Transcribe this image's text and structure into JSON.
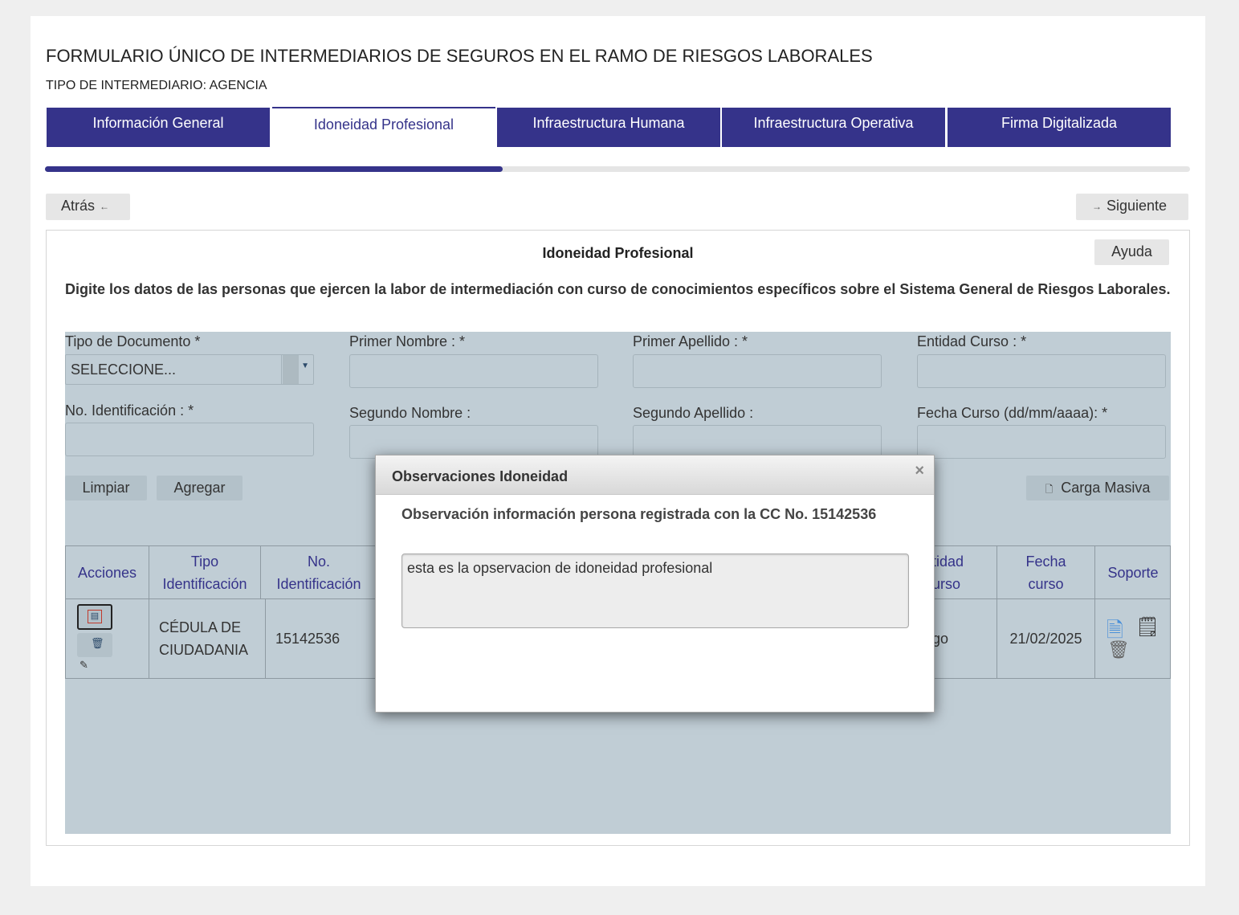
{
  "header": {
    "title": "FORMULARIO ÚNICO DE INTERMEDIARIOS DE SEGUROS EN EL RAMO DE RIESGOS LABORALES",
    "subtitle": "TIPO DE INTERMEDIARIO: AGENCIA"
  },
  "tabs": [
    {
      "label": "Información General",
      "active": false
    },
    {
      "label": "Idoneidad Profesional",
      "active": true
    },
    {
      "label": "Infraestructura Humana",
      "active": false
    },
    {
      "label": "Infraestructura Operativa",
      "active": false
    },
    {
      "label": "Firma Digitalizada",
      "active": false
    }
  ],
  "progress": {
    "fraction": 0.4
  },
  "nav": {
    "back_label": "Atrás",
    "next_label": "Siguiente"
  },
  "panel": {
    "title": "Idoneidad Profesional",
    "help_label": "Ayuda",
    "instructions": "Digite los datos de las personas que ejercen la labor de intermediación con curso de conocimientos específicos sobre el Sistema General de Riesgos Laborales."
  },
  "form": {
    "tipo_documento": {
      "label": "Tipo de Documento *",
      "value": "SELECCIONE..."
    },
    "primer_nombre": {
      "label": "Primer Nombre : *",
      "value": ""
    },
    "primer_apellido": {
      "label": "Primer Apellido : *",
      "value": ""
    },
    "entidad_curso": {
      "label": "Entidad Curso : *",
      "value": ""
    },
    "no_identificacion": {
      "label": "No. Identificación : *",
      "value": ""
    },
    "segundo_nombre": {
      "label": "Segundo Nombre :",
      "value": ""
    },
    "segundo_apellido": {
      "label": "Segundo Apellido :",
      "value": ""
    },
    "fecha_curso": {
      "label": "Fecha Curso (dd/mm/aaaa): *",
      "value": ""
    },
    "clear_label": "Limpiar",
    "add_label": "Agregar",
    "bulk_label": "Carga Masiva"
  },
  "table": {
    "headers": {
      "acciones": "Acciones",
      "tipo_id_1": "Tipo",
      "tipo_id_2": "Identificación",
      "no_id_1": "No.",
      "no_id_2": "Identificación",
      "entidad_1": "tidad",
      "entidad_2": "urso",
      "fecha_1": "Fecha",
      "fecha_2": "curso",
      "soporte": "Soporte"
    },
    "row": {
      "tipo_1": "CÉDULA DE",
      "tipo_2": "CIUDADANIA",
      "numero": "15142536",
      "entidad_fragment": "go",
      "fecha": "21/02/2025"
    }
  },
  "modal": {
    "title": "Observaciones Idoneidad",
    "close_glyph": "×",
    "subtitle": "Observación información persona registrada con la CC No. 15142536",
    "observation": "esta es la opservacion de idoneidad profesional"
  },
  "colors": {
    "brand": "#35338a",
    "grey_area": "#c0cdd5"
  },
  "icons": [
    "arrow-left-icon",
    "arrow-right-icon",
    "document-icon",
    "observation-icon",
    "trash-icon",
    "pencil-icon",
    "file-check-icon",
    "file-text-icon",
    "close-icon",
    "chevron-down-icon"
  ]
}
